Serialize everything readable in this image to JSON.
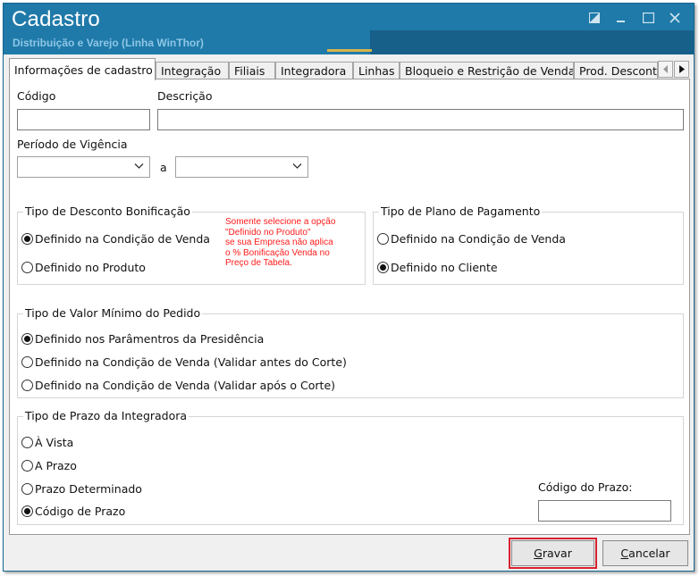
{
  "window": {
    "title": "Cadastro",
    "subtitle": "Distribuição e Varejo (Linha WinThor)"
  },
  "tabs": [
    {
      "label": "Informações de cadastro",
      "active": true
    },
    {
      "label": "Integração",
      "active": false
    },
    {
      "label": "Filiais",
      "active": false
    },
    {
      "label": "Integradora",
      "active": false
    },
    {
      "label": "Linhas",
      "active": false
    },
    {
      "label": "Bloqueio e Restrição de Venda",
      "active": false
    },
    {
      "label": "Prod. Desconto",
      "active": false
    }
  ],
  "form": {
    "codigo_label": "Código",
    "codigo_value": "",
    "descricao_label": "Descrição",
    "descricao_value": "",
    "periodo_label": "Período de Vigência",
    "periodo_start": "",
    "periodo_sep": "a",
    "periodo_end": ""
  },
  "desconto_group": {
    "title": "Tipo de Desconto Bonificação",
    "options": [
      {
        "label": "Definido na Condição de Venda",
        "checked": true
      },
      {
        "label": "Definido no Produto",
        "checked": false
      }
    ],
    "note": [
      "Somente selecione a opção",
      "\"Definido no Produto\"",
      "se sua Empresa não aplica",
      "o % Bonificação Venda no",
      "Preço de Tabela."
    ]
  },
  "plano_group": {
    "title": "Tipo de Plano de Pagamento",
    "options": [
      {
        "label": "Definido na Condição de Venda",
        "checked": false
      },
      {
        "label": "Definido no Cliente",
        "checked": true
      }
    ]
  },
  "valor_minimo_group": {
    "title": "Tipo de Valor Mínimo do Pedido",
    "options": [
      {
        "label": "Definido nos Parâmentros da Presidência",
        "checked": true
      },
      {
        "label": "Definido na Condição  de Venda (Validar antes do Corte)",
        "checked": false
      },
      {
        "label": "Definido na Condição de Venda (Validar após o Corte)",
        "checked": false
      }
    ]
  },
  "prazo_group": {
    "title": "Tipo de Prazo da Integradora",
    "options": [
      {
        "label": "À Vista",
        "checked": false
      },
      {
        "label": "A Prazo",
        "checked": false
      },
      {
        "label": "Prazo Determinado",
        "checked": false
      },
      {
        "label": "Código de Prazo",
        "checked": true
      }
    ],
    "codigo_prazo_label": "Código do Prazo:",
    "codigo_prazo_value": ""
  },
  "buttons": {
    "gravar_mnemonic": "G",
    "gravar_rest": "ravar",
    "cancelar_mnemonic": "C",
    "cancelar_rest": "ancelar"
  },
  "colors": {
    "titlebar": "#1f7aa9",
    "note_text": "#ff1a1a",
    "highlight": "#d8202f"
  }
}
